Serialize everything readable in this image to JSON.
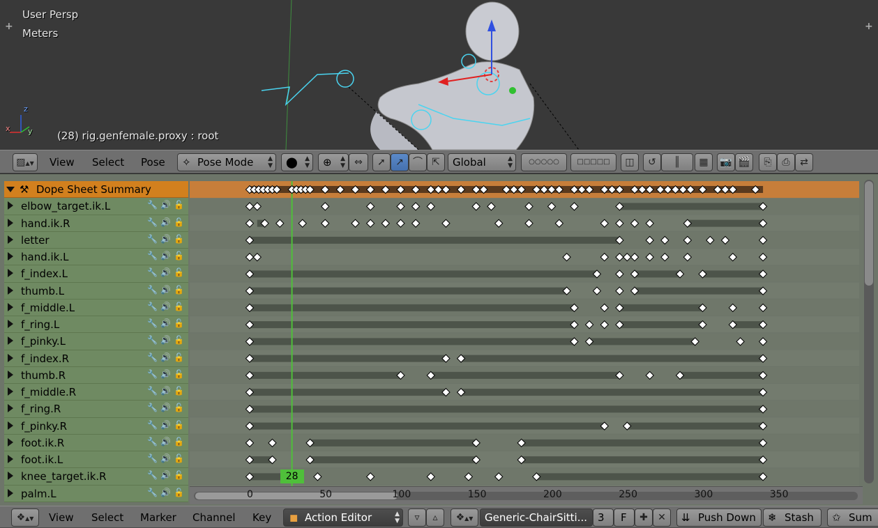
{
  "viewport": {
    "view_name": "User Persp",
    "units": "Meters",
    "object_info": "(28) rig.genfemale.proxy : root",
    "axis_z": "z",
    "axis_y": "y",
    "axis_x": "x"
  },
  "top_header": {
    "menus": [
      "View",
      "Select",
      "Pose"
    ],
    "mode": "Pose Mode",
    "orientation": "Global"
  },
  "dopesheet": {
    "current_frame": "28",
    "frame_range": [
      0,
      340
    ],
    "ruler_ticks": [
      "0",
      "50",
      "100",
      "150",
      "200",
      "250",
      "300",
      "350"
    ],
    "summary": {
      "label": "Dope Sheet Summary",
      "keys": [
        0,
        3,
        6,
        9,
        12,
        15,
        18,
        28,
        31,
        34,
        37,
        40,
        50,
        60,
        70,
        80,
        90,
        100,
        110,
        120,
        125,
        130,
        140,
        150,
        155,
        170,
        175,
        180,
        190,
        195,
        200,
        205,
        215,
        220,
        225,
        235,
        240,
        245,
        255,
        260,
        265,
        272,
        277,
        282,
        287,
        292,
        300,
        310,
        315,
        320,
        335
      ]
    },
    "channels": [
      {
        "label": "elbow_target.ik.L",
        "keys": [
          0,
          5,
          50,
          80,
          100,
          110,
          120,
          150,
          160,
          185,
          200,
          215,
          245,
          340
        ],
        "holds": [
          [
            245,
            340
          ]
        ]
      },
      {
        "label": "hand.ik.R",
        "keys": [
          0,
          10,
          20,
          35,
          50,
          70,
          80,
          90,
          100,
          110,
          130,
          165,
          185,
          205,
          235,
          245,
          255,
          265,
          290,
          340
        ],
        "holds": [
          [
            5,
            10
          ],
          [
            290,
            340
          ]
        ]
      },
      {
        "label": "letter",
        "keys": [
          0,
          245,
          265,
          275,
          290,
          305,
          315,
          340
        ],
        "holds": [
          [
            0,
            245
          ]
        ]
      },
      {
        "label": "hand.ik.L",
        "keys": [
          0,
          5,
          210,
          235,
          245,
          250,
          255,
          265,
          275,
          290,
          320,
          340
        ],
        "holds": []
      },
      {
        "label": "f_index.L",
        "keys": [
          0,
          230,
          245,
          255,
          285,
          300,
          340
        ],
        "holds": [
          [
            0,
            230
          ],
          [
            255,
            285
          ],
          [
            300,
            340
          ]
        ]
      },
      {
        "label": "thumb.L",
        "keys": [
          0,
          210,
          230,
          245,
          255,
          340
        ],
        "holds": [
          [
            0,
            210
          ],
          [
            255,
            340
          ]
        ]
      },
      {
        "label": "f_middle.L",
        "keys": [
          0,
          215,
          235,
          245,
          300,
          320,
          340
        ],
        "holds": [
          [
            0,
            215
          ],
          [
            245,
            300
          ]
        ]
      },
      {
        "label": "f_ring.L",
        "keys": [
          0,
          215,
          225,
          235,
          245,
          300,
          320,
          340
        ],
        "holds": [
          [
            0,
            215
          ],
          [
            245,
            300
          ],
          [
            320,
            340
          ]
        ]
      },
      {
        "label": "f_pinky.L",
        "keys": [
          0,
          215,
          225,
          295,
          325,
          340
        ],
        "holds": [
          [
            0,
            215
          ],
          [
            225,
            295
          ]
        ]
      },
      {
        "label": "f_index.R",
        "keys": [
          0,
          130,
          140,
          340
        ],
        "holds": [
          [
            0,
            130
          ],
          [
            140,
            340
          ]
        ]
      },
      {
        "label": "thumb.R",
        "keys": [
          0,
          100,
          120,
          245,
          265,
          285,
          340
        ],
        "holds": [
          [
            0,
            100
          ],
          [
            120,
            245
          ],
          [
            285,
            340
          ]
        ]
      },
      {
        "label": "f_middle.R",
        "keys": [
          0,
          130,
          140,
          340
        ],
        "holds": [
          [
            0,
            130
          ],
          [
            140,
            340
          ]
        ]
      },
      {
        "label": "f_ring.R",
        "keys": [
          0,
          340
        ],
        "holds": [
          [
            0,
            340
          ]
        ]
      },
      {
        "label": "f_pinky.R",
        "keys": [
          0,
          235,
          250,
          340
        ],
        "holds": [
          [
            0,
            235
          ],
          [
            250,
            340
          ]
        ]
      },
      {
        "label": "foot.ik.R",
        "keys": [
          0,
          15,
          40,
          150,
          180,
          340
        ],
        "holds": [
          [
            40,
            150
          ],
          [
            180,
            340
          ]
        ]
      },
      {
        "label": "foot.ik.L",
        "keys": [
          0,
          15,
          40,
          150,
          180,
          340
        ],
        "holds": [
          [
            0,
            15
          ],
          [
            40,
            150
          ],
          [
            180,
            340
          ]
        ]
      },
      {
        "label": "knee_target.ik.R",
        "keys": [
          0,
          25,
          45,
          80,
          120,
          145,
          165,
          190,
          340
        ],
        "holds": [
          [
            0,
            25
          ],
          [
            190,
            340
          ]
        ]
      },
      {
        "label": "palm.L",
        "keys": [],
        "holds": []
      }
    ]
  },
  "bottom_header": {
    "menus": [
      "View",
      "Select",
      "Marker",
      "Channel",
      "Key"
    ],
    "editor_mode": "Action Editor",
    "action_name": "Generic-ChairSitti...",
    "users": "3",
    "fake_user": "F",
    "push_down": "Push Down",
    "stash": "Stash",
    "summary_short": "Sum"
  },
  "colors": {
    "summary_orange": "#d2801e",
    "channel_green": "#6f8a62",
    "frame_line": "#4fbf3a",
    "selected_blue": "#4570ae"
  }
}
